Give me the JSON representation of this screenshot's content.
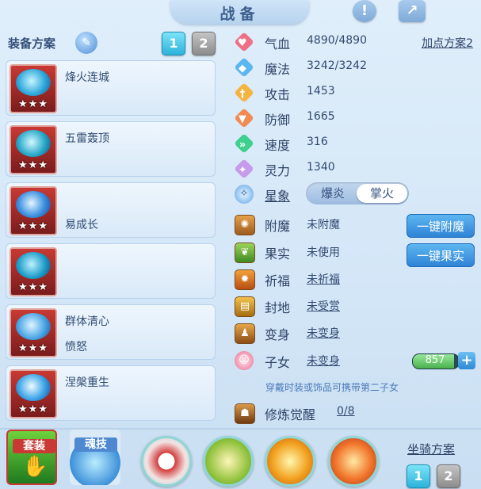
{
  "title": "战备",
  "header_icons": {
    "alert": "!",
    "export": "↗"
  },
  "left": {
    "label": "装备方案",
    "edit_icon": "pen-icon",
    "tabs": [
      {
        "label": "1",
        "active": true
      },
      {
        "label": "2",
        "active": false
      }
    ],
    "equipment": [
      {
        "stars": "★★★",
        "line1": "烽火连城",
        "line2": ""
      },
      {
        "stars": "★★★",
        "line1": "五雷轰顶",
        "line2": ""
      },
      {
        "stars": "★★★",
        "line1": "",
        "line2": "易成长"
      },
      {
        "stars": "★★★",
        "line1": "",
        "line2": ""
      },
      {
        "stars": "★★★",
        "line1": "群体清心",
        "line2": "愤怒"
      },
      {
        "stars": "★★★",
        "line1": "涅槃重生",
        "line2": ""
      }
    ]
  },
  "stats": {
    "plan_link": "加点方案2",
    "hp": {
      "label": "气血",
      "value": "4890/4890",
      "color": "#ef6f86"
    },
    "mp": {
      "label": "魔法",
      "value": "3242/3242",
      "color": "#5bb6f2"
    },
    "atk": {
      "label": "攻击",
      "value": "1453",
      "color": "#f3b440"
    },
    "def": {
      "label": "防御",
      "value": "1665",
      "color": "#f28a52"
    },
    "spd": {
      "label": "速度",
      "value": "316",
      "color": "#3ed08f"
    },
    "spirit": {
      "label": "灵力",
      "value": "1340",
      "color": "#c69bed"
    }
  },
  "xingxiang": {
    "label": "星象",
    "options": [
      "爆炎",
      "掌火"
    ],
    "active_index": 1
  },
  "extras": {
    "fumo": {
      "label": "附魔",
      "value": "未附魔",
      "button": "一键附魔"
    },
    "guoshi": {
      "label": "果实",
      "value": "未使用",
      "button": "一键果实"
    },
    "qifu": {
      "label": "祈福",
      "value": "未祈福"
    },
    "fengdi": {
      "label": "封地",
      "value": "未受赏"
    },
    "bianshen": {
      "label": "变身",
      "value": "未变身"
    },
    "zinv": {
      "label": "子女",
      "value": "未变身",
      "bar_value": "857",
      "bar_fill": 0.9
    },
    "hint": "穿戴时装或饰品可携带第二子女",
    "xiulian": {
      "label": "修炼觉醒",
      "value": "0/8"
    }
  },
  "bottom": {
    "suit_tag": "套装",
    "soul_tag": "魂技",
    "mount_label": "坐骑方案",
    "mount_tabs": [
      {
        "label": "1",
        "active": true
      },
      {
        "label": "2",
        "active": false
      }
    ]
  }
}
